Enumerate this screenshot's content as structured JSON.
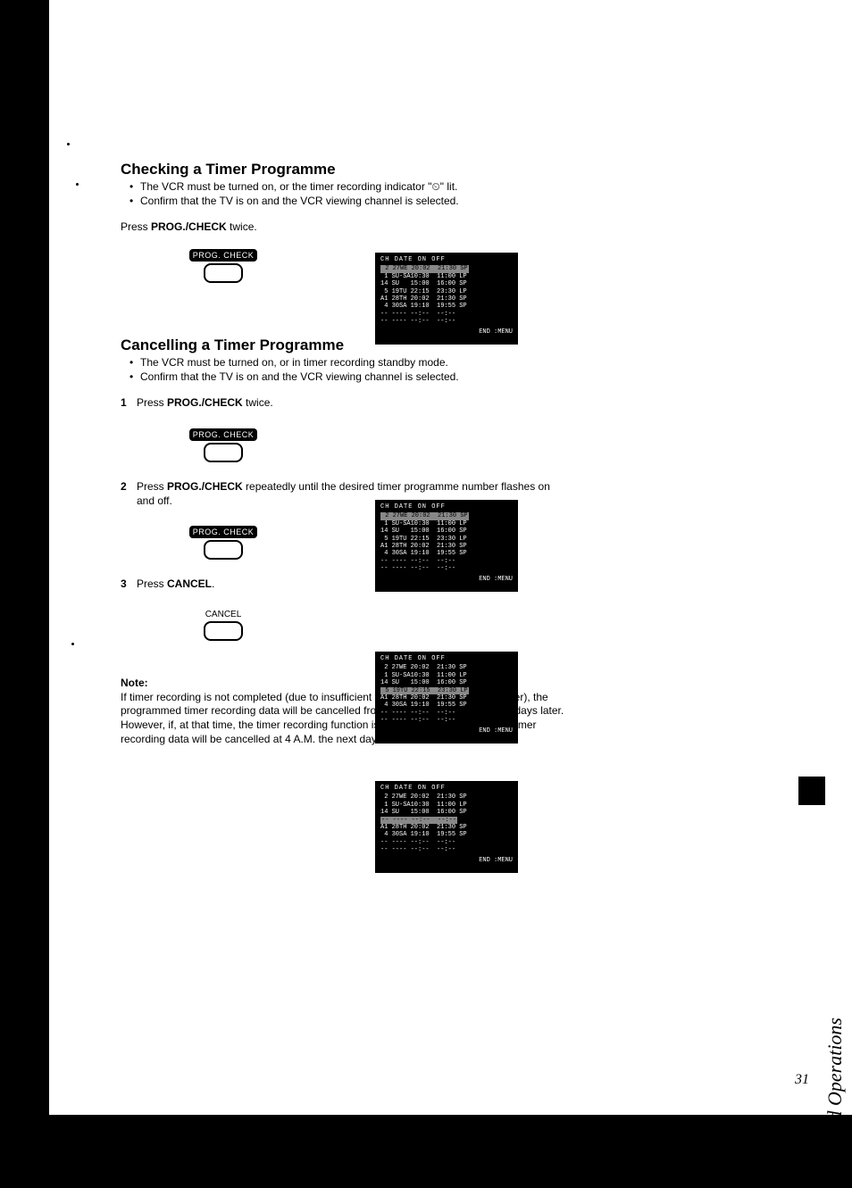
{
  "section1": {
    "heading": "Checking a Timer Programme",
    "bullets": [
      "The VCR must be turned on, or the timer recording indicator \"⏲\" lit.",
      "Confirm that the TV is on and the VCR viewing channel is selected."
    ],
    "instruction": "Press PROG./CHECK twice.",
    "button_label": "PROG. CHECK"
  },
  "section2": {
    "heading": "Cancelling a Timer Programme",
    "bullets": [
      "The VCR must be turned on, or in timer recording standby mode.",
      "Confirm that the TV is on and the VCR viewing channel is selected."
    ],
    "steps": [
      {
        "num": "1",
        "text": "Press PROG./CHECK twice.",
        "button_label": "PROG. CHECK"
      },
      {
        "num": "2",
        "text": "Press PROG./CHECK repeatedly until the desired timer programme number flashes on and off.",
        "button_label": "PROG. CHECK"
      },
      {
        "num": "3",
        "text": "Press CANCEL.",
        "button_label": "CANCEL"
      }
    ]
  },
  "note": {
    "heading": "Note:",
    "body": "If timer recording is not completed (due to insufficient tape or cancellation by the user), the programmed timer recording data will be cancelled from the memory by 4 A.M. two days later.\nHowever, if, at that time, the timer recording function is activated, the programmed timer recording data will be cancelled at 4 A.M. the next day."
  },
  "screens": {
    "header": "CH DATE  ON     OFF",
    "rows_plain": [
      " 1 SU-SA10:30  11:00 LP",
      "14 SU   15:00  16:00 SP",
      " 5 19TU 22:15  23:30 LP",
      "A1 28TH 20:02  21:30 SP",
      " 4 30SA 19:10  19:55 SP",
      "-- ---- --:--  --:--",
      "-- ---- --:--  --:--"
    ],
    "highlight_row1": " 2 27WE 20:02  21:30 SP",
    "highlight_row2": " 5 19TU 22:15  23:30 LP",
    "footer": "END :MENU"
  },
  "side_label": "Advanced Operations",
  "page_number": "31"
}
